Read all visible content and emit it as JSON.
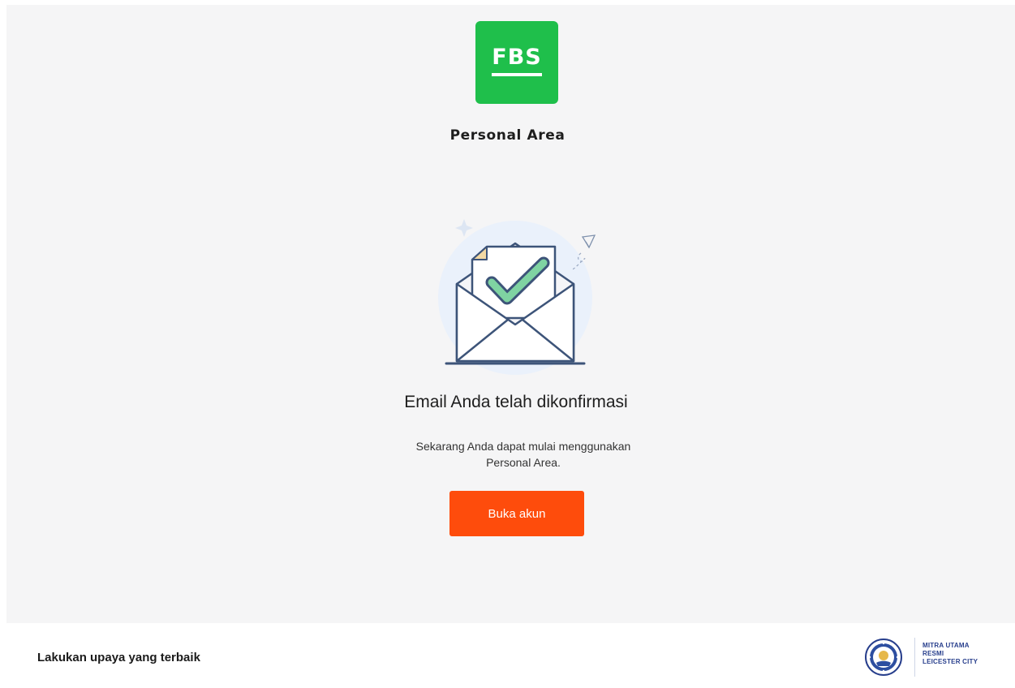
{
  "brand": {
    "logo_text": "FBS",
    "title": "Personal Area"
  },
  "confirmation": {
    "headline": "Email Anda telah dikonfirmasi",
    "message_line1": "Sekarang Anda dapat mulai menggunakan",
    "message_line2": "Personal Area.",
    "button_label": "Buka akun"
  },
  "footer": {
    "slogan": "Lakukan upaya yang terbaik",
    "partner_line1": "MITRA UTAMA",
    "partner_line2": "RESMI",
    "partner_line3": "LEICESTER CITY"
  },
  "icons": {
    "illustration": "envelope-checkmark-icon",
    "partner_badge": "leicester-city-crest-icon"
  },
  "colors": {
    "brand_green": "#1fbf4b",
    "cta_orange": "#fe4c0c",
    "partner_blue": "#273e8c"
  }
}
